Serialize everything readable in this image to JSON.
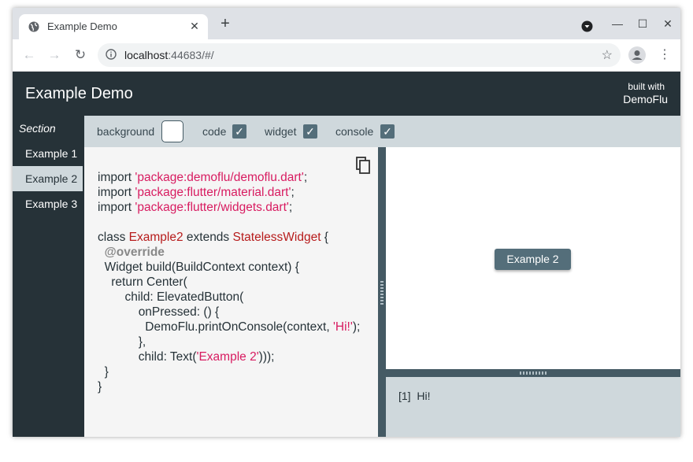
{
  "browser": {
    "tab_title": "Example Demo",
    "tab_close": "✕",
    "new_tab": "+",
    "url_host": "localhost",
    "url_rest": ":44683/#/",
    "window_min": "—",
    "window_max": "☐",
    "window_close": "✕",
    "back": "←",
    "forward": "→",
    "reload": "↻",
    "star": "☆",
    "menu": "⋮"
  },
  "app": {
    "title": "Example Demo",
    "built_with_line1": "built with",
    "built_with_line2": "DemoFlu"
  },
  "sidebar": {
    "section_label": "Section",
    "items": [
      {
        "label": "Example 1"
      },
      {
        "label": "Example 2"
      },
      {
        "label": "Example 3"
      }
    ],
    "active_index": 1
  },
  "options": {
    "background": {
      "label": "background",
      "checked": false
    },
    "code": {
      "label": "code",
      "checked": true
    },
    "widget": {
      "label": "widget",
      "checked": true
    },
    "console": {
      "label": "console",
      "checked": true
    },
    "check_glyph": "✓"
  },
  "code": {
    "import_kw": "import",
    "imports": [
      "'package:demoflu/demoflu.dart'",
      "'package:flutter/material.dart'",
      "'package:flutter/widgets.dart'"
    ],
    "class_kw": "class",
    "class_name": "Example2",
    "extends_kw": "extends",
    "super_class": "StatelessWidget",
    "annotation": "@override",
    "build_sig": "Widget build(BuildContext context) {",
    "return_kw": "return",
    "return_rest": "Center(",
    "child_line": "child: ElevatedButton(",
    "onpressed_line": "onPressed: () {",
    "print_call": "DemoFlu.printOnConsole(context, ",
    "print_arg": "'Hi!'",
    "print_close": ");",
    "closing1": "},",
    "child_text_start": "child: Text(",
    "text_arg": "'Example 2'",
    "child_text_end": ")));",
    "brace": "}",
    "semi": ";"
  },
  "widget": {
    "button_label": "Example 2"
  },
  "console": {
    "lines": [
      {
        "index": "[1]",
        "text": "Hi!"
      }
    ]
  },
  "colors": {
    "appbar": "#263238",
    "accent": "#546e7a",
    "panel": "#cfd8dc",
    "string": "#d81b60",
    "class": "#b71c1c"
  }
}
